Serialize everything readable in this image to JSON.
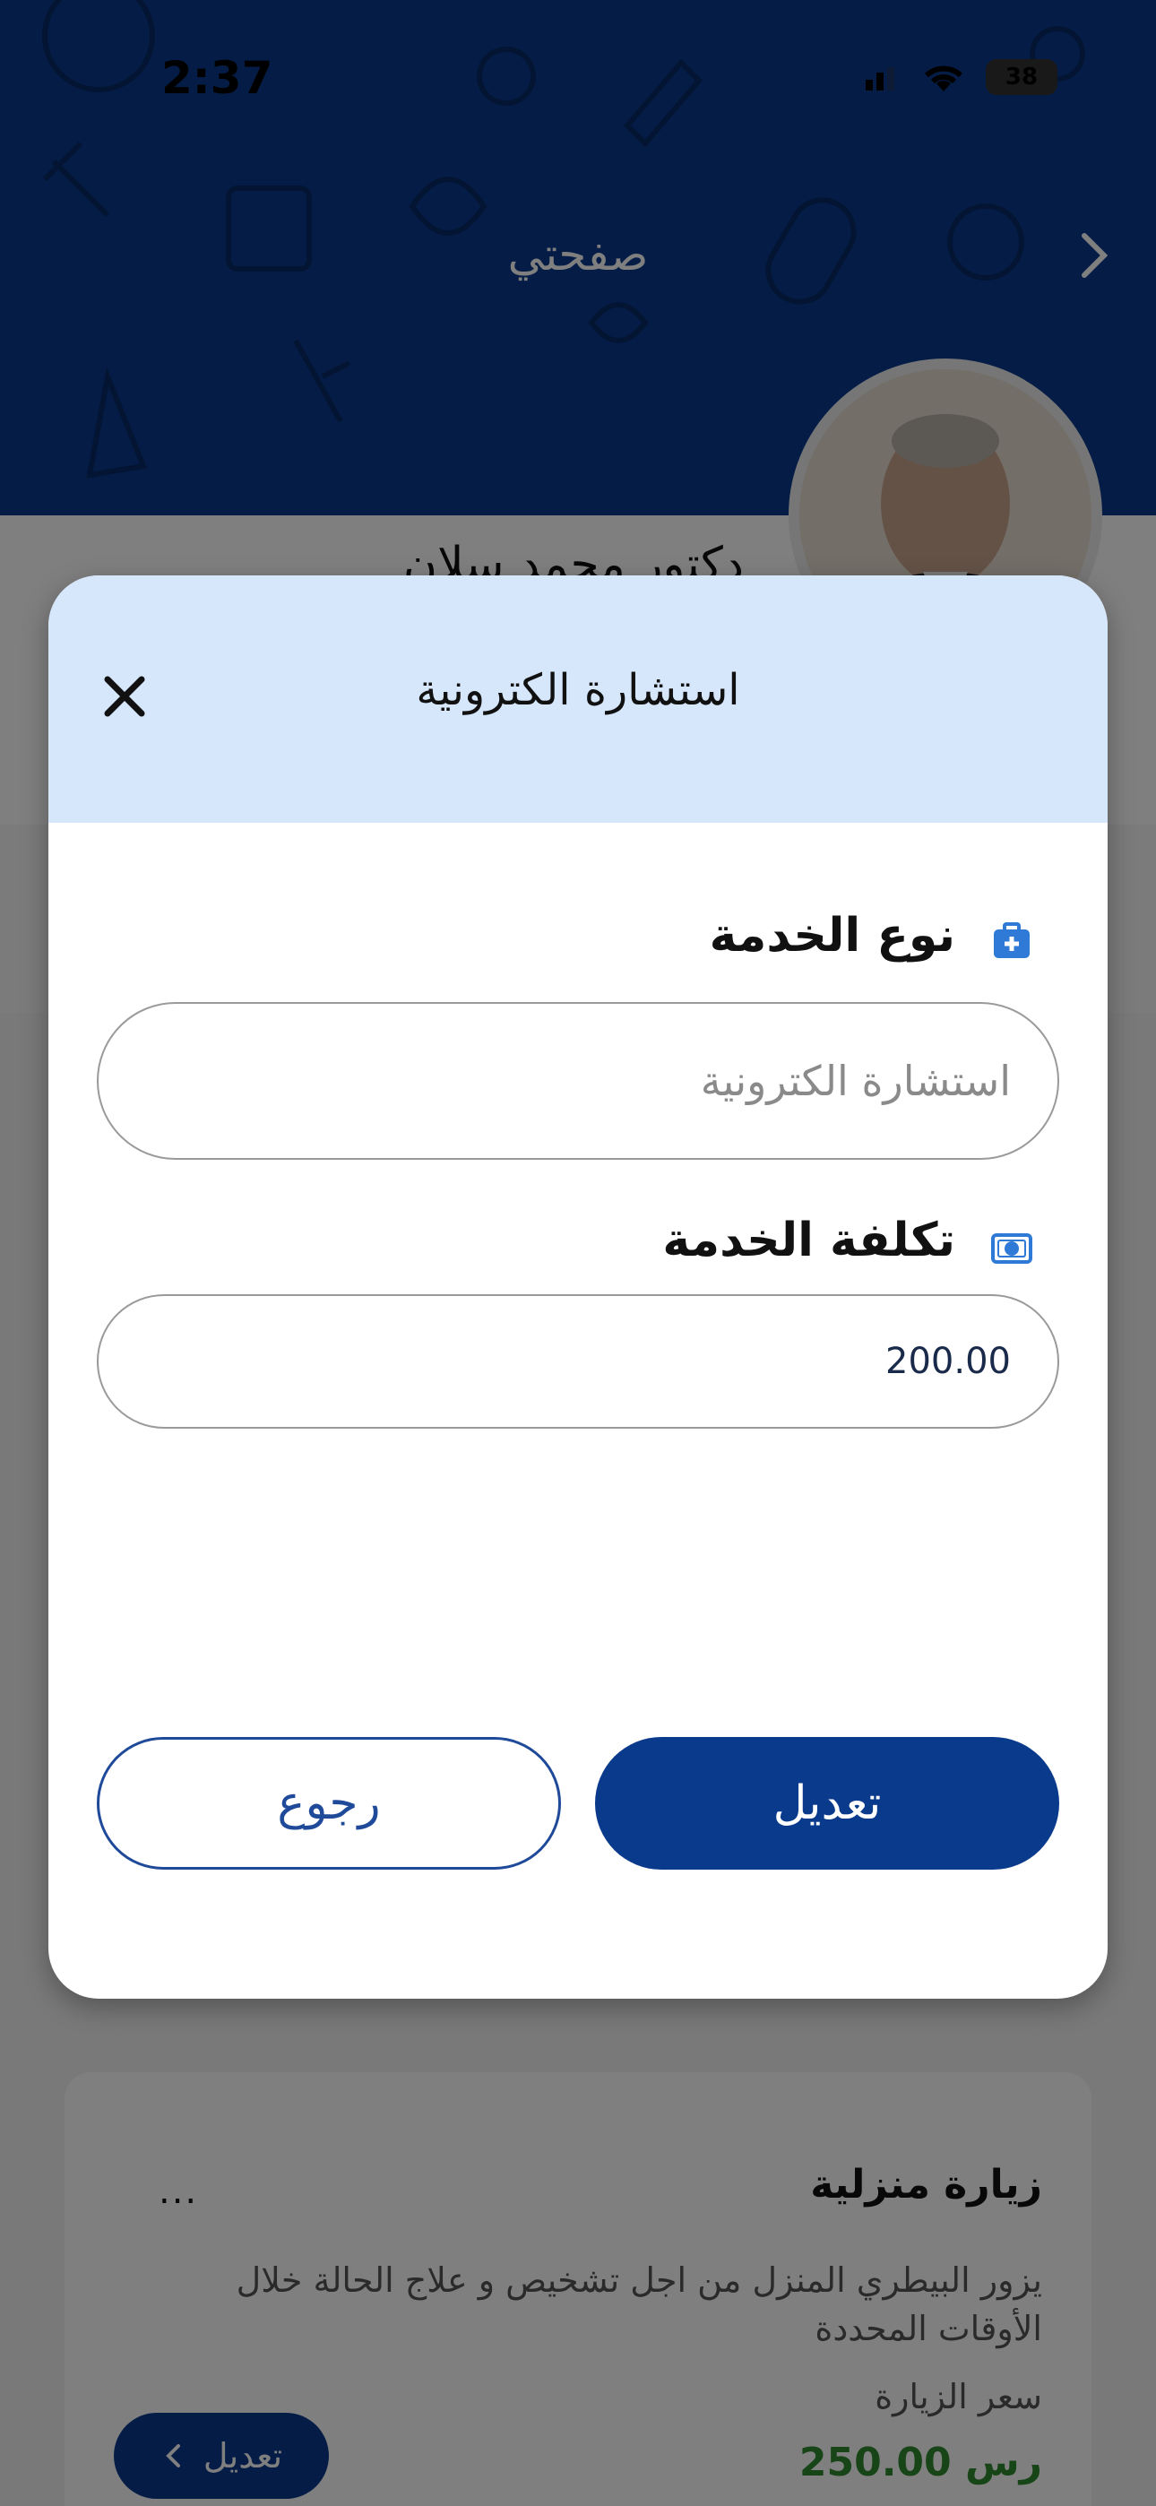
{
  "status_bar": {
    "time": "2:37",
    "battery": "38"
  },
  "header": {
    "title": "صفحتي"
  },
  "profile": {
    "name": "دكتور محمد سلان"
  },
  "modal": {
    "title": "استشارة الكترونية",
    "service_type_label": "نوع الخدمة",
    "service_type_placeholder": "استشارة الكترونية",
    "service_cost_label": "تكلفة الخدمة",
    "service_cost_value": "200.00",
    "edit_label": "تعديل",
    "back_label": "رجوع"
  },
  "service_card": {
    "title": "زيارة منزلية",
    "menu": "...",
    "description": "يزور البيطري المنزل من اجل تشخيص و علاج الحالة خلال الأوقات المحددة",
    "price_label": "سعر الزيارة",
    "price_value": "250.00 رس",
    "edit_label": "تعديل"
  },
  "colors": {
    "brand_blue": "#0a3a8c",
    "modal_header": "#d6e6fb",
    "price_green": "#2e8b2e"
  }
}
